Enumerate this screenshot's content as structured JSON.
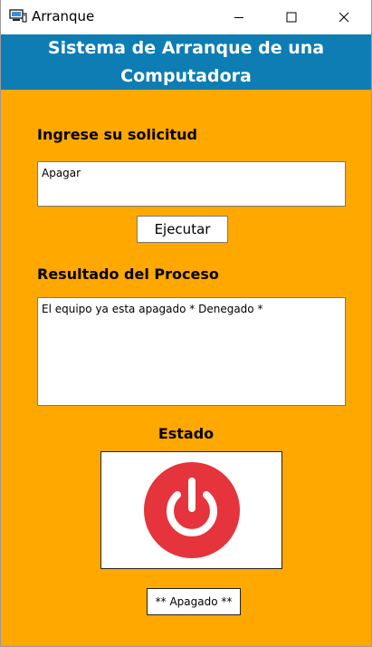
{
  "window": {
    "title": "Arranque",
    "icon": "computer-icon"
  },
  "header": {
    "line1": "Sistema de Arranque de una",
    "line2": "Computadora",
    "color": "#0D7DB3"
  },
  "form": {
    "request_label": "Ingrese su solicitud",
    "request_value": "Apagar",
    "execute_button": "Ejecutar",
    "result_label": "Resultado del Proceso",
    "result_value": "El equipo ya esta apagado * Denegado *"
  },
  "status": {
    "label": "Estado",
    "icon": "power-icon",
    "icon_color": "#E5343C",
    "text": "** Apagado **"
  },
  "colors": {
    "background": "#FFA800"
  }
}
